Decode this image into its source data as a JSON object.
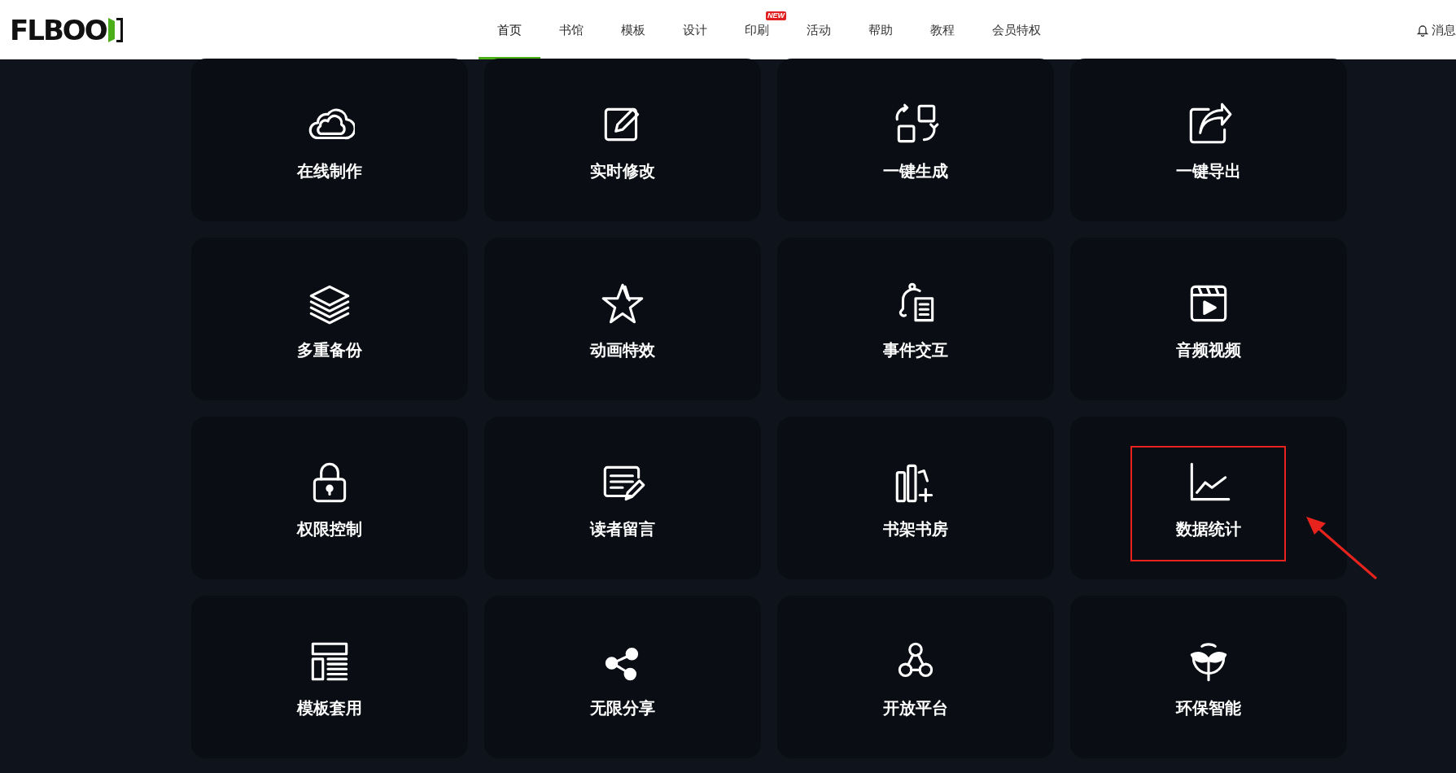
{
  "header": {
    "logo": "FLBOO",
    "nav": [
      {
        "label": "首页",
        "selected": true
      },
      {
        "label": "书馆",
        "selected": false
      },
      {
        "label": "模板",
        "selected": false
      },
      {
        "label": "设计",
        "selected": false
      },
      {
        "label": "印刷",
        "selected": false,
        "badge": "NEW"
      },
      {
        "label": "活动",
        "selected": false
      },
      {
        "label": "帮助",
        "selected": false
      },
      {
        "label": "教程",
        "selected": false
      },
      {
        "label": "会员特权",
        "selected": false
      }
    ],
    "messages": "消息"
  },
  "features": [
    {
      "label": "在线制作",
      "highlighted": false
    },
    {
      "label": "实时修改",
      "highlighted": false
    },
    {
      "label": "一键生成",
      "highlighted": false
    },
    {
      "label": "一键导出",
      "highlighted": false
    },
    {
      "label": "多重备份",
      "highlighted": false
    },
    {
      "label": "动画特效",
      "highlighted": false
    },
    {
      "label": "事件交互",
      "highlighted": false
    },
    {
      "label": "音频视频",
      "highlighted": false
    },
    {
      "label": "权限控制",
      "highlighted": false
    },
    {
      "label": "读者留言",
      "highlighted": false
    },
    {
      "label": "书架书房",
      "highlighted": false
    },
    {
      "label": "数据统计",
      "highlighted": true
    },
    {
      "label": "模板套用",
      "highlighted": false
    },
    {
      "label": "无限分享",
      "highlighted": false
    },
    {
      "label": "开放平台",
      "highlighted": false
    },
    {
      "label": "环保智能",
      "highlighted": false
    }
  ]
}
